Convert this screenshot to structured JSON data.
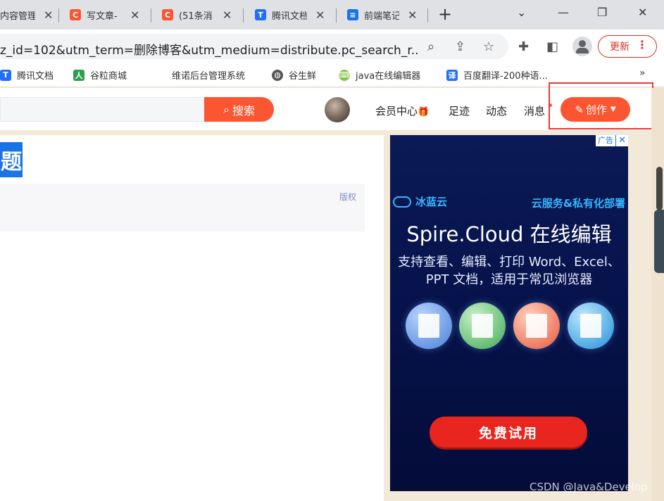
{
  "tabs": [
    {
      "title": "内容管理",
      "favicon": "csdn",
      "color": "#fc5531"
    },
    {
      "title": "写文章-",
      "favicon": "csdn",
      "color": "#fc5531"
    },
    {
      "title": "(51条消",
      "favicon": "csdn",
      "color": "#fc5531"
    },
    {
      "title": "腾讯文档",
      "favicon": "tencent-docs",
      "color": "#1e6fff"
    },
    {
      "title": "前端笔记",
      "favicon": "doc",
      "color": "#1a73e8"
    }
  ],
  "address": {
    "url": "z_id=102&utm_term=删除博客&utm_medium=distribute.pc_search_r..."
  },
  "update_button": "更新",
  "bookmarks": [
    {
      "label": "腾讯文档",
      "icon": "tencent-docs",
      "color": "#1e6fff"
    },
    {
      "label": "谷粒商城",
      "icon": "person",
      "color": "#2e9e4f"
    },
    {
      "label": "维诺后台管理系统",
      "icon": "none",
      "color": "#ffffff"
    },
    {
      "label": "谷生鲜",
      "icon": "globe",
      "color": "#555555"
    },
    {
      "label": "java在线编辑器",
      "icon": "editor",
      "color": "#8bc34a"
    },
    {
      "label": "百度翻译-200种语...",
      "icon": "translate",
      "color": "#1e6fff"
    }
  ],
  "csdn": {
    "search_button": "搜索",
    "nav": {
      "vip": "会员中心",
      "footprint": "足迹",
      "dynamic": "动态",
      "messages": "消息"
    },
    "create_button": "创作"
  },
  "article": {
    "title_fragment": "题",
    "copyright": "版权"
  },
  "ad": {
    "badge": "广告",
    "close": "✕",
    "brand": "冰蓝云",
    "slogan": "云服务&私有化部署",
    "title": "Spire.Cloud 在线编辑",
    "desc_line1": "支持查看、编辑、打印 Word、Excel、",
    "desc_line2": "PPT 文档，适用于常见浏览器",
    "cta": "免费试用",
    "icons": [
      "word-icon",
      "excel-icon",
      "ppt-icon",
      "cloud-edit-icon"
    ]
  },
  "watermark": "CSDN @Java&Develop",
  "colors": {
    "csdn_red": "#fc5531",
    "highlight": "#e53935",
    "ad_bg": "#06124a"
  }
}
